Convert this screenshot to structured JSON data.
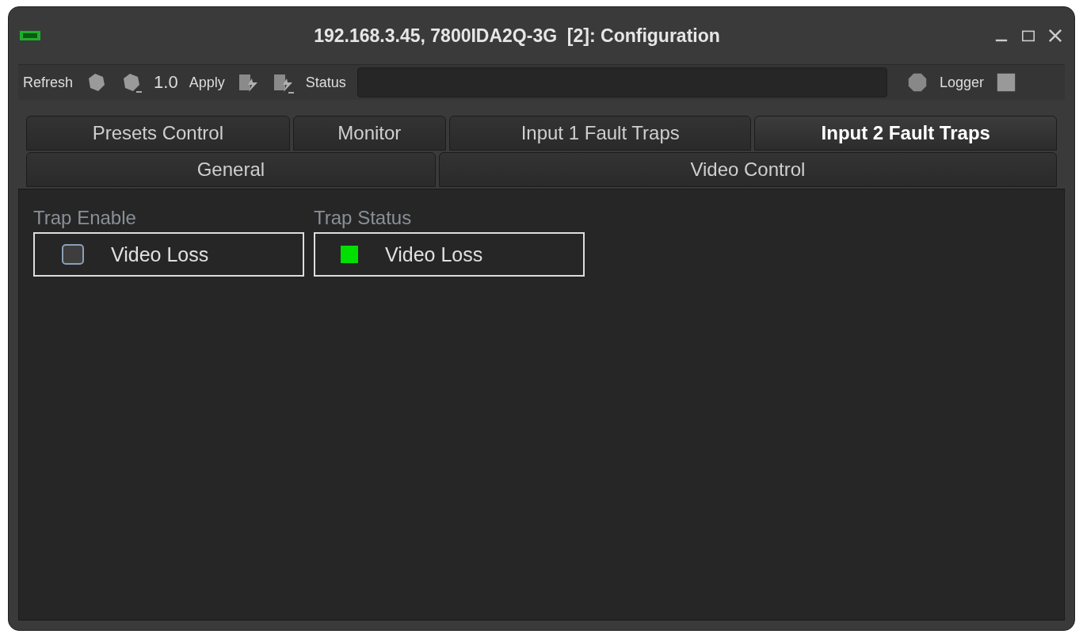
{
  "window": {
    "title": "192.168.3.45, 7800IDA2Q-3G  [2]: Configuration"
  },
  "toolbar": {
    "refresh_label": "Refresh",
    "version": "1.0",
    "apply_label": "Apply",
    "status_label": "Status",
    "logger_label": "Logger"
  },
  "tab_rows": [
    [
      {
        "label": "Presets Control",
        "selected": false
      },
      {
        "label": "Monitor",
        "selected": false
      },
      {
        "label": "Input 1 Fault Traps",
        "selected": false
      },
      {
        "label": "Input 2 Fault Traps",
        "selected": true
      }
    ],
    [
      {
        "label": "General",
        "selected": false
      },
      {
        "label": "Video Control",
        "selected": false
      }
    ]
  ],
  "trap_enable": {
    "title": "Trap Enable",
    "items": [
      {
        "label": "Video Loss",
        "checked": false
      }
    ]
  },
  "trap_status": {
    "title": "Trap Status",
    "items": [
      {
        "label": "Video Loss",
        "on": true
      }
    ]
  }
}
